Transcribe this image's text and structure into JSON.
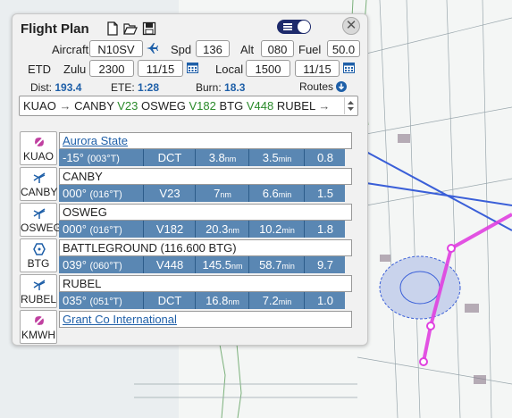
{
  "panel": {
    "title": "Flight Plan"
  },
  "header_icons": [
    "new-file-icon",
    "folder-open-icon",
    "save-icon"
  ],
  "aircraft": {
    "label": "Aircraft",
    "value": "N10SV"
  },
  "speed": {
    "label": "Spd",
    "value": "136"
  },
  "altitude": {
    "label": "Alt",
    "value": "080"
  },
  "fuel": {
    "label": "Fuel",
    "value": "50.0"
  },
  "etd": {
    "label": "ETD",
    "zulu_label": "Zulu",
    "zulu_time": "2300",
    "zulu_date": "11/15",
    "local_label": "Local",
    "local_time": "1500",
    "local_date": "11/15"
  },
  "stats": {
    "dist_label": "Dist:",
    "dist": "193.4",
    "ete_label": "ETE:",
    "ete": "1:28",
    "burn_label": "Burn:",
    "burn": "18.3",
    "routes_label": "Routes"
  },
  "route": {
    "parts": [
      {
        "text": "KUAO",
        "color": "#222222"
      },
      {
        "text": "CANBY",
        "color": "#222222"
      },
      {
        "text": "V23",
        "color": "#2a8a2a"
      },
      {
        "text": "OSWEG",
        "color": "#222222"
      },
      {
        "text": "V182",
        "color": "#2a8a2a"
      },
      {
        "text": "BTG",
        "color": "#222222"
      },
      {
        "text": "V448",
        "color": "#2a8a2a"
      },
      {
        "text": "RUBEL",
        "color": "#222222"
      }
    ]
  },
  "waypoints": [
    {
      "id": "KUAO",
      "icon": "airport-icon",
      "name": "Aurora State",
      "link": true,
      "leg": {
        "course": "-15°",
        "mag": "(003°T)",
        "via": "DCT",
        "dist": "3.8",
        "dist_unit": "nm",
        "time": "3.5",
        "time_unit": "min",
        "fuel": "0.8"
      }
    },
    {
      "id": "CANBY",
      "icon": "intersection-icon",
      "name": "CANBY",
      "link": false,
      "leg": {
        "course": "000°",
        "mag": "(016°T)",
        "via": "V23",
        "dist": "7",
        "dist_unit": "nm",
        "time": "6.6",
        "time_unit": "min",
        "fuel": "1.5"
      }
    },
    {
      "id": "OSWEG",
      "icon": "intersection-icon",
      "name": "OSWEG",
      "link": false,
      "leg": {
        "course": "000°",
        "mag": "(016°T)",
        "via": "V182",
        "dist": "20.3",
        "dist_unit": "nm",
        "time": "10.2",
        "time_unit": "min",
        "fuel": "1.8"
      }
    },
    {
      "id": "BTG",
      "icon": "vor-icon",
      "name": "BATTLEGROUND (116.600 BTG)",
      "link": false,
      "leg": {
        "course": "039°",
        "mag": "(060°T)",
        "via": "V448",
        "dist": "145.5",
        "dist_unit": "nm",
        "time": "58.7",
        "time_unit": "min",
        "fuel": "9.7"
      }
    },
    {
      "id": "RUBEL",
      "icon": "intersection-icon",
      "name": "RUBEL",
      "link": false,
      "leg": {
        "course": "035°",
        "mag": "(051°T)",
        "via": "DCT",
        "dist": "16.8",
        "dist_unit": "nm",
        "time": "7.2",
        "time_unit": "min",
        "fuel": "1.0"
      }
    },
    {
      "id": "KMWH",
      "icon": "airport-icon",
      "name": "Grant Co International",
      "link": true,
      "leg": null
    }
  ],
  "colors": {
    "leg_row": "#5a87b3",
    "link": "#1e5fa8",
    "airway": "#2a8a2a",
    "route_line": "#e040e0",
    "toggle": "#1d2a6b",
    "map_blue": "#3a5fd8"
  }
}
